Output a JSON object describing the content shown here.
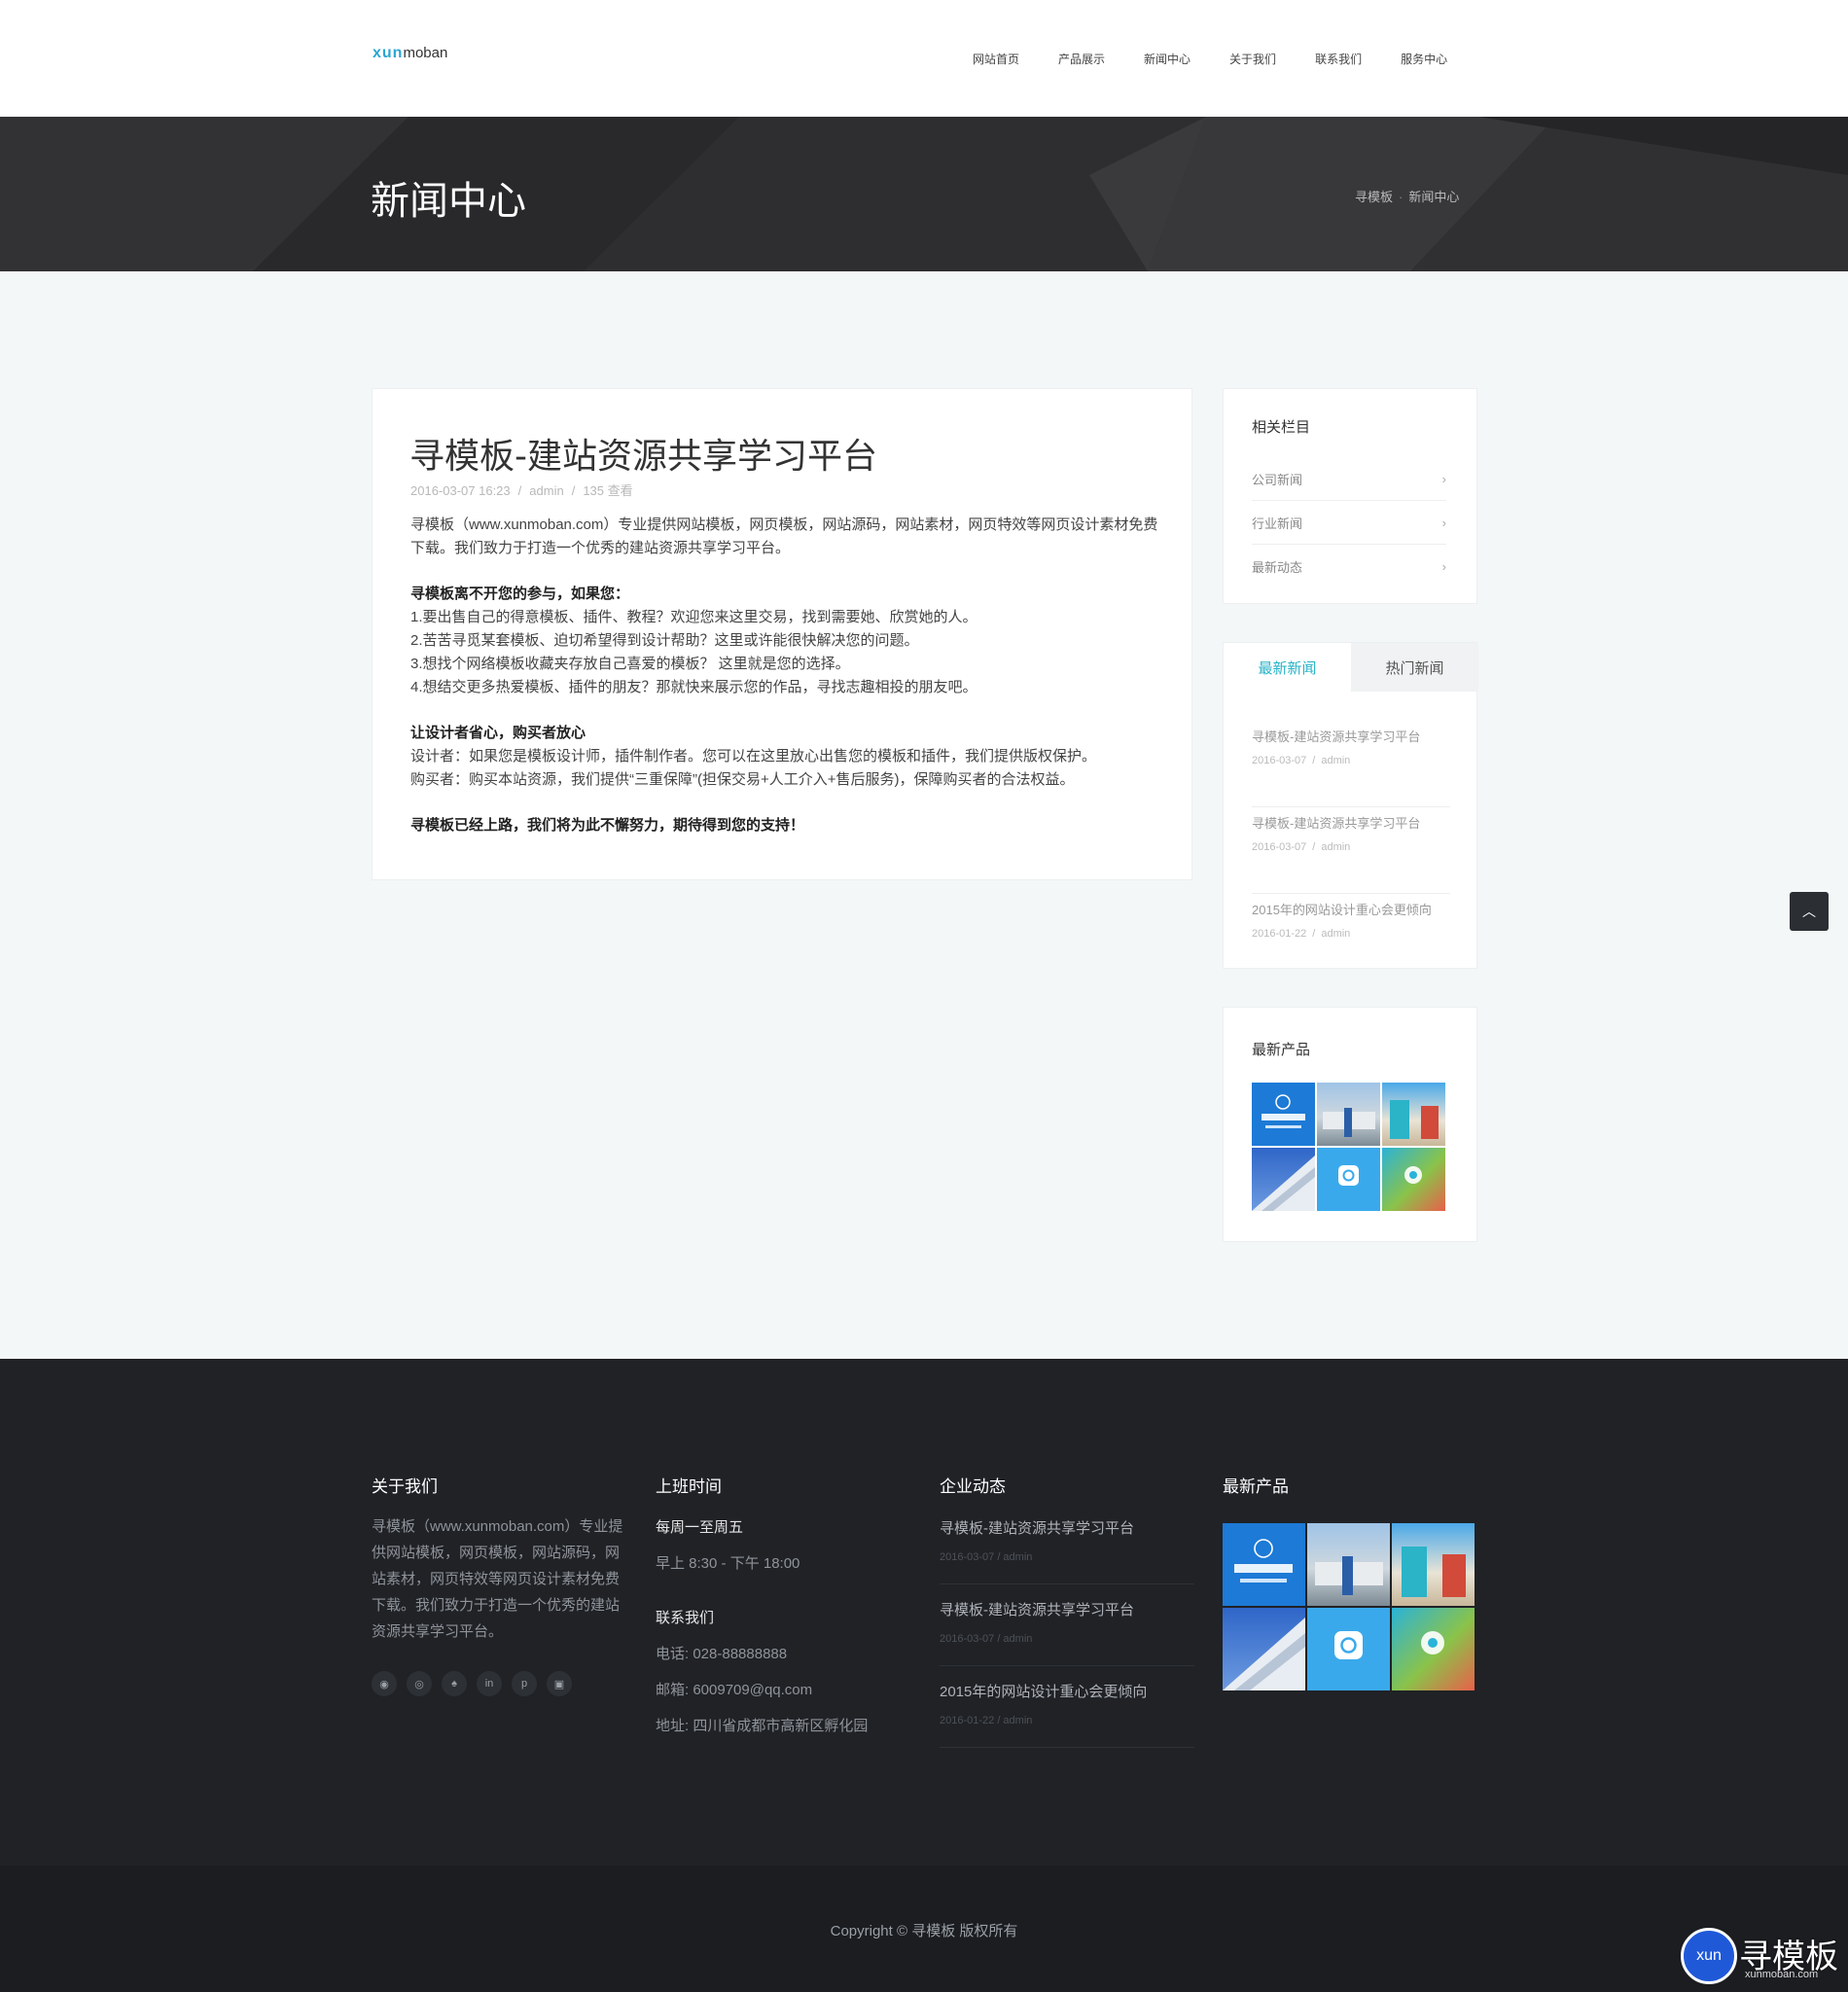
{
  "logo": {
    "part1": "xun",
    "part2": "moban"
  },
  "nav": [
    "网站首页",
    "产品展示",
    "新闻中心",
    "关于我们",
    "联系我们",
    "服务中心"
  ],
  "banner": {
    "title": "新闻中心",
    "crumb_home": "寻模板",
    "crumb_current": "新闻中心"
  },
  "article": {
    "title": "寻模板-建站资源共享学习平台",
    "date": "2016-03-07 16:23",
    "author": "admin",
    "views": "135 查看",
    "p1": "寻模板（www.xunmoban.com）专业提供网站模板，网页模板，网站源码，网站素材，网页特效等网页设计素材免费下载。我们致力于打造一个优秀的建站资源共享学习平台。",
    "h2": "寻模板离不开您的参与，如果您：",
    "l1": "1.要出售自己的得意模板、插件、教程？欢迎您来这里交易，找到需要她、欣赏她的人。",
    "l2": "2.苦苦寻觅某套模板、迫切希望得到设计帮助？这里或许能很快解决您的问题。",
    "l3": "3.想找个网络模板收藏夹存放自己喜爱的模板？ 这里就是您的选择。",
    "l4": "4.想结交更多热爱模板、插件的朋友？那就快来展示您的作品，寻找志趣相投的朋友吧。",
    "h3": "让设计者省心，购买者放心",
    "d1": "设计者：如果您是模板设计师，插件制作者。您可以在这里放心出售您的模板和插件，我们提供版权保护。",
    "d2": "购买者：购买本站资源，我们提供“三重保障”(担保交易+人工介入+售后服务)，保障购买者的合法权益。",
    "h4": "寻模板已经上路，我们将为此不懈努力，期待得到您的支持！"
  },
  "sidebar": {
    "categories_title": "相关栏目",
    "categories": [
      "公司新闻",
      "行业新闻",
      "最新动态"
    ],
    "tab_latest": "最新新闻",
    "tab_hot": "热门新闻",
    "news": [
      {
        "title": "寻模板-建站资源共享学习平台",
        "date": "2016-03-07",
        "author": "admin"
      },
      {
        "title": "寻模板-建站资源共享学习平台",
        "date": "2016-03-07",
        "author": "admin"
      },
      {
        "title": "2015年的网站设计重心会更倾向",
        "date": "2016-01-22",
        "author": "admin"
      }
    ],
    "products_title": "最新产品"
  },
  "footer": {
    "about_title": "关于我们",
    "about_text": "寻模板（www.xunmoban.com）专业提供网站模板，网页模板，网站源码，网站素材，网页特效等网页设计素材免费下载。我们致力于打造一个优秀的建站资源共享学习平台。",
    "hours_title": "上班时间",
    "hours_days": "每周一至周五",
    "hours_time": "早上 8:30 - 下午 18:00",
    "contact_title": "联系我们",
    "phone": "电话: 028-88888888",
    "email": "邮箱: 6009709@qq.com",
    "address": "地址: 四川省成都市高新区孵化园",
    "news_title": "企业动态",
    "news": [
      {
        "title": "寻模板-建站资源共享学习平台",
        "date": "2016-03-07 / admin"
      },
      {
        "title": "寻模板-建站资源共享学习平台",
        "date": "2016-03-07 / admin"
      },
      {
        "title": "2015年的网站设计重心会更倾向",
        "date": "2016-01-22 / admin"
      }
    ],
    "products_title": "最新产品",
    "social_icons": [
      "wechat-icon",
      "weibo-icon",
      "qq-icon",
      "linkedin-icon",
      "pinterest-icon",
      "instagram-icon"
    ],
    "copyright": "Copyright © 寻模板 版权所有"
  },
  "watermark": {
    "circle": "xun",
    "text": "寻模板",
    "sub": "xunmoban.com"
  },
  "colors": {
    "accent": "#26b3c7",
    "brand_blue": "#2aa6d4",
    "footer_bg": "#202226",
    "banner_bg": "#2b2b2d"
  }
}
